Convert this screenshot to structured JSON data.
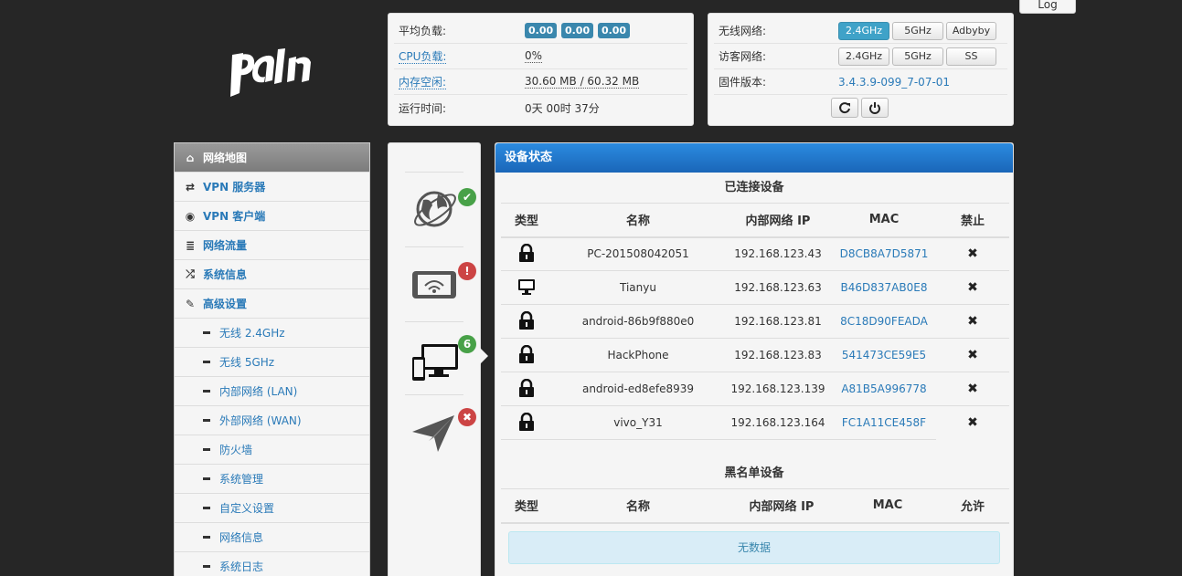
{
  "top": {
    "log_label": "Log"
  },
  "stats": {
    "load_label": "平均负载:",
    "load_values": [
      "0.00",
      "0.00",
      "0.00"
    ],
    "cpu_label": "CPU负载:",
    "cpu_value": "0%",
    "mem_label": "内存空闲:",
    "mem_value": "30.60 MB / 60.32 MB",
    "uptime_label": "运行时间:",
    "uptime_value": "0天 00时 37分"
  },
  "wifi": {
    "wireless_label": "无线网络:",
    "wireless_buttons": [
      "2.4GHz",
      "5GHz",
      "Adbyby"
    ],
    "guest_label": "访客网络:",
    "guest_buttons": [
      "2.4GHz",
      "5GHz",
      "SS"
    ],
    "firmware_label": "固件版本:",
    "firmware_value": "3.4.3.9-099_7-07-01"
  },
  "menu": {
    "items": [
      {
        "label": "网络地图",
        "icon": "home-icon"
      },
      {
        "label": "VPN 服务器",
        "icon": "retweet-icon"
      },
      {
        "label": "VPN 客户端",
        "icon": "globe-icon"
      },
      {
        "label": "网络流量",
        "icon": "list-icon"
      },
      {
        "label": "系统信息",
        "icon": "random-icon"
      },
      {
        "label": "高级设置",
        "icon": "wrench-icon"
      }
    ],
    "subs": [
      "无线 2.4GHz",
      "无线 5GHz",
      "内部网络 (LAN)",
      "外部网络 (WAN)",
      "防火墙",
      "系统管理",
      "自定义设置",
      "网络信息",
      "系统日志"
    ]
  },
  "side_icons": {
    "client_count": "6"
  },
  "devices": {
    "title": "设备状态",
    "connected_title": "已连接设备",
    "headers": [
      "类型",
      "名称",
      "内部网络 IP",
      "MAC",
      "禁止"
    ],
    "rows": [
      {
        "type": "lock",
        "name": "PC-201508042051",
        "ip": "192.168.123.43",
        "mac": "D8CB8A7D5871"
      },
      {
        "type": "monitor",
        "name": "Tianyu",
        "ip": "192.168.123.63",
        "mac": "B46D837AB0E8"
      },
      {
        "type": "lock",
        "name": "android-86b9f880e0",
        "ip": "192.168.123.81",
        "mac": "8C18D90FEADA"
      },
      {
        "type": "lock",
        "name": "HackPhone",
        "ip": "192.168.123.83",
        "mac": "541473CE59E5"
      },
      {
        "type": "lock",
        "name": "android-ed8efe8939",
        "ip": "192.168.123.139",
        "mac": "A81B5A996778"
      },
      {
        "type": "lock",
        "name": "vivo_Y31",
        "ip": "192.168.123.164",
        "mac": "FC1A11CE458F"
      }
    ],
    "blacklist_title": "黑名单设备",
    "blacklist_headers": [
      "类型",
      "名称",
      "内部网络 IP",
      "MAC",
      "允许"
    ],
    "no_data": "无数据"
  }
}
